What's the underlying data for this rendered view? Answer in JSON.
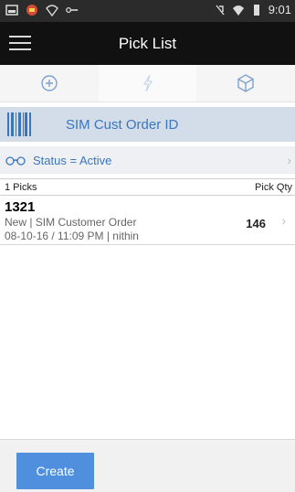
{
  "status_bar": {
    "time": "9:01"
  },
  "header": {
    "title": "Pick List"
  },
  "tabs": [
    {
      "icon": "plus-circle-icon"
    },
    {
      "icon": "lightning-icon"
    },
    {
      "icon": "package-icon"
    }
  ],
  "scan": {
    "label": "SIM Cust Order ID"
  },
  "filter": {
    "label": "Status = Active"
  },
  "list_header": {
    "count_label": "1 Picks",
    "qty_label": "Pick Qty"
  },
  "rows": [
    {
      "number": "1321",
      "line1": "New  |  SIM Customer Order",
      "line2": "08-10-16 / 11:09 PM  |  nithin",
      "qty": "146"
    }
  ],
  "footer": {
    "create_label": "Create"
  },
  "colors": {
    "accent": "#3a77bd",
    "app_bar": "#111111",
    "scan_bg": "#d3ddea",
    "button": "#4f8fdd"
  }
}
